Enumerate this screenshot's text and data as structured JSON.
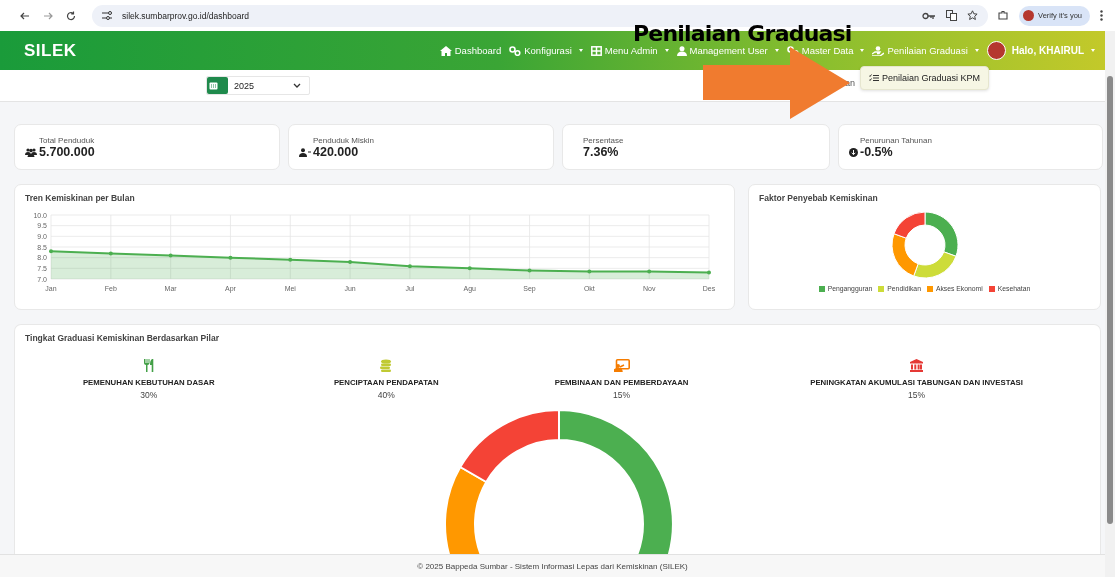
{
  "browser": {
    "url": "silek.sumbarprov.go.id/dashboard",
    "profile_label": "Verify it's you"
  },
  "navbar": {
    "logo": "SILEK",
    "items": [
      {
        "label": "Dashboard",
        "kind": "home",
        "dropdown": false
      },
      {
        "label": "Konfigurasi",
        "kind": "gears",
        "dropdown": true
      },
      {
        "label": "Menu Admin",
        "kind": "grid",
        "dropdown": true
      },
      {
        "label": "Management User",
        "kind": "user",
        "dropdown": true
      },
      {
        "label": "Master Data",
        "kind": "gears",
        "dropdown": true
      },
      {
        "label": "Penilaian Graduasi",
        "kind": "user-hand",
        "dropdown": true
      }
    ],
    "user": {
      "greeting": "Halo, KHAIRUL",
      "dropdown": true
    }
  },
  "annotation": {
    "title": "Penilaian Graduasi"
  },
  "dropdown_menu": {
    "items": [
      {
        "label": "Penilaian Graduasi KPM"
      }
    ]
  },
  "toolbar": {
    "year": "2025",
    "hidden_text": "an"
  },
  "stats": [
    {
      "label": "Total Penduduk",
      "value": "5.700.000",
      "kind": "people"
    },
    {
      "label": "Penduduk Miskin",
      "value": "420.000",
      "kind": "user-minus"
    },
    {
      "label": "Persentase",
      "value": "7.36%",
      "kind": "plain"
    },
    {
      "label": "Penurunan Tahunan",
      "value": "-0.5%",
      "kind": "down"
    }
  ],
  "trend": {
    "title": "Tren Kemiskinan per Bulan",
    "chart_data": {
      "type": "area",
      "categories": [
        "Jan",
        "Feb",
        "Mar",
        "Apr",
        "Mei",
        "Jun",
        "Jul",
        "Agu",
        "Sep",
        "Okt",
        "Nov",
        "Des"
      ],
      "grid": true,
      "series": [
        {
          "color": "#4caf50",
          "values": [
            8.3,
            8.2,
            8.1,
            8.0,
            7.9,
            7.8,
            7.6,
            7.5,
            7.4,
            7.35,
            7.35,
            7.3
          ]
        }
      ],
      "ylim": [
        7.0,
        10.0
      ],
      "yticks": [
        {
          "value": 7,
          "label": "7.0"
        },
        {
          "value": 7.5,
          "label": "7.5"
        },
        {
          "value": 8,
          "label": "8.0"
        },
        {
          "value": 8.5,
          "label": "8.5"
        },
        {
          "value": 9,
          "label": "9.0"
        },
        {
          "value": 9.5,
          "label": "9.5"
        },
        {
          "value": 10,
          "label": "10.0"
        }
      ]
    }
  },
  "factors": {
    "title": "Faktor Penyebab Kemiskinan",
    "legend": [
      {
        "label": "Pengangguran",
        "color": "#4caf50"
      },
      {
        "label": "Pendidikan",
        "color": "#cddc39"
      },
      {
        "label": "Akses Ekonomi",
        "color": "#ff9800"
      },
      {
        "label": "Kesehatan",
        "color": "#f44336"
      }
    ]
  },
  "pillars": {
    "title": "Tingkat Graduasi Kemiskinan Berdasarkan Pilar",
    "items": [
      {
        "label": "PEMENUHAN KEBUTUHAN DASAR",
        "percent": "30%",
        "kind": "utensils",
        "color": "#43a047"
      },
      {
        "label": "PENCIPTAAN PENDAPATAN",
        "percent": "40%",
        "kind": "coins",
        "color": "#c0ca33"
      },
      {
        "label": "PEMBINAAN DAN PEMBERDAYAAN",
        "percent": "15%",
        "kind": "teach",
        "color": "#f57c00"
      },
      {
        "label": "PENINGKATAN AKUMULASI TABUNGAN DAN INVESTASI",
        "percent": "15%",
        "kind": "bank",
        "color": "#e53935"
      }
    ]
  },
  "footer": {
    "text": "© 2025 Bappeda Sumbar - Sistem Informasi Lepas dari Kemiskinan (SILEK)"
  }
}
